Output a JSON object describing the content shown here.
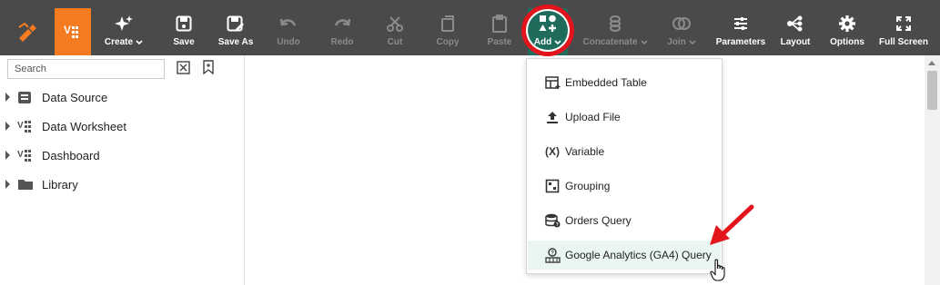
{
  "toolbar": {
    "buttons": [
      {
        "id": "create",
        "label": "Create",
        "icon": "sparkle-icon",
        "dropdown": true,
        "enabled": true
      },
      {
        "id": "save",
        "label": "Save",
        "icon": "floppy-icon",
        "enabled": true
      },
      {
        "id": "save_as",
        "label": "Save As",
        "icon": "floppy-pencil-icon",
        "enabled": true
      },
      {
        "id": "undo",
        "label": "Undo",
        "icon": "undo-icon",
        "enabled": false
      },
      {
        "id": "redo",
        "label": "Redo",
        "icon": "redo-icon",
        "enabled": false
      },
      {
        "id": "cut",
        "label": "Cut",
        "icon": "scissors-icon",
        "enabled": false
      },
      {
        "id": "copy",
        "label": "Copy",
        "icon": "copy-icon",
        "enabled": false
      },
      {
        "id": "paste",
        "label": "Paste",
        "icon": "clipboard-icon",
        "enabled": false
      },
      {
        "id": "add",
        "label": "Add",
        "icon": "shapes-plus-icon",
        "dropdown": true,
        "enabled": true,
        "active": true
      },
      {
        "id": "concatenate",
        "label": "Concatenate",
        "icon": "concatenate-icon",
        "dropdown": true,
        "enabled": false
      },
      {
        "id": "join",
        "label": "Join",
        "icon": "join-icon",
        "dropdown": true,
        "enabled": false
      },
      {
        "id": "parameters",
        "label": "Parameters",
        "icon": "sliders-icon",
        "enabled": true
      },
      {
        "id": "layout",
        "label": "Layout",
        "icon": "layout-tree-icon",
        "enabled": true
      },
      {
        "id": "options",
        "label": "Options",
        "icon": "gear-icon",
        "enabled": true
      },
      {
        "id": "full_screen",
        "label": "Full Screen",
        "icon": "expand-icon",
        "enabled": true
      }
    ]
  },
  "sidebar": {
    "search_placeholder": "Search",
    "items": [
      {
        "label": "Data Source",
        "icon": "database-icon"
      },
      {
        "label": "Data Worksheet",
        "icon": "worksheet-icon"
      },
      {
        "label": "Dashboard",
        "icon": "dashboard-icon"
      },
      {
        "label": "Library",
        "icon": "folder-icon"
      }
    ]
  },
  "add_menu": {
    "items": [
      {
        "label": "Embedded Table",
        "icon": "embedded-table-icon"
      },
      {
        "label": "Upload File",
        "icon": "upload-icon"
      },
      {
        "label": "Variable",
        "icon": "variable-icon"
      },
      {
        "label": "Grouping",
        "icon": "grouping-icon"
      },
      {
        "label": "Orders Query",
        "icon": "database-query-icon"
      },
      {
        "label": "Google Analytics (GA4) Query",
        "icon": "analytics-query-icon",
        "highlighted": true
      }
    ]
  },
  "colors": {
    "toolbar_bg": "#4a4a4a",
    "brand_orange": "#f47b20",
    "active_teal": "#1f6b5c",
    "annotation_red": "#e4141c",
    "menu_hover": "#eaf6f2"
  }
}
